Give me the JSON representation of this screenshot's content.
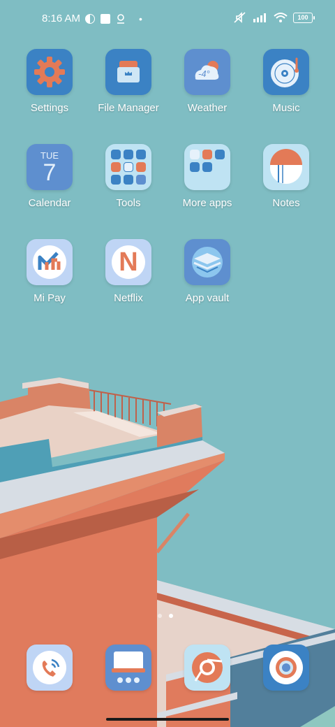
{
  "status_bar": {
    "time": "8:16 AM",
    "battery": "100",
    "icons": [
      "dnd-icon",
      "square-notification-icon",
      "location-icon",
      "dot-icon",
      "mute-icon",
      "signal-icon",
      "wifi-icon",
      "battery-icon"
    ]
  },
  "apps": [
    {
      "label": "Settings",
      "icon": "gear-icon"
    },
    {
      "label": "File Manager",
      "icon": "folder-icon"
    },
    {
      "label": "Weather",
      "icon": "cloud-sun-icon",
      "temp": "-4°"
    },
    {
      "label": "Music",
      "icon": "vinyl-icon"
    },
    {
      "label": "Calendar",
      "icon": "calendar-icon",
      "day": "TUE",
      "date": "7"
    },
    {
      "label": "Tools",
      "icon": "folder-tools-icon"
    },
    {
      "label": "More apps",
      "icon": "folder-apps-icon"
    },
    {
      "label": "Notes",
      "icon": "notes-icon"
    },
    {
      "label": "Mi Pay",
      "icon": "mipay-icon"
    },
    {
      "label": "Netflix",
      "icon": "netflix-icon",
      "letter": "N"
    },
    {
      "label": "App vault",
      "icon": "app-vault-icon"
    }
  ],
  "dock": [
    {
      "icon": "phone-icon"
    },
    {
      "icon": "messages-icon"
    },
    {
      "icon": "chrome-icon"
    },
    {
      "icon": "camera-icon"
    }
  ],
  "colors": {
    "background": "#7fbdc3",
    "icon_blue": "#3b82c4",
    "icon_light": "#bfe3f3",
    "accent_orange": "#e37a57"
  },
  "page_indicator": {
    "pages": 2,
    "active": 2
  }
}
